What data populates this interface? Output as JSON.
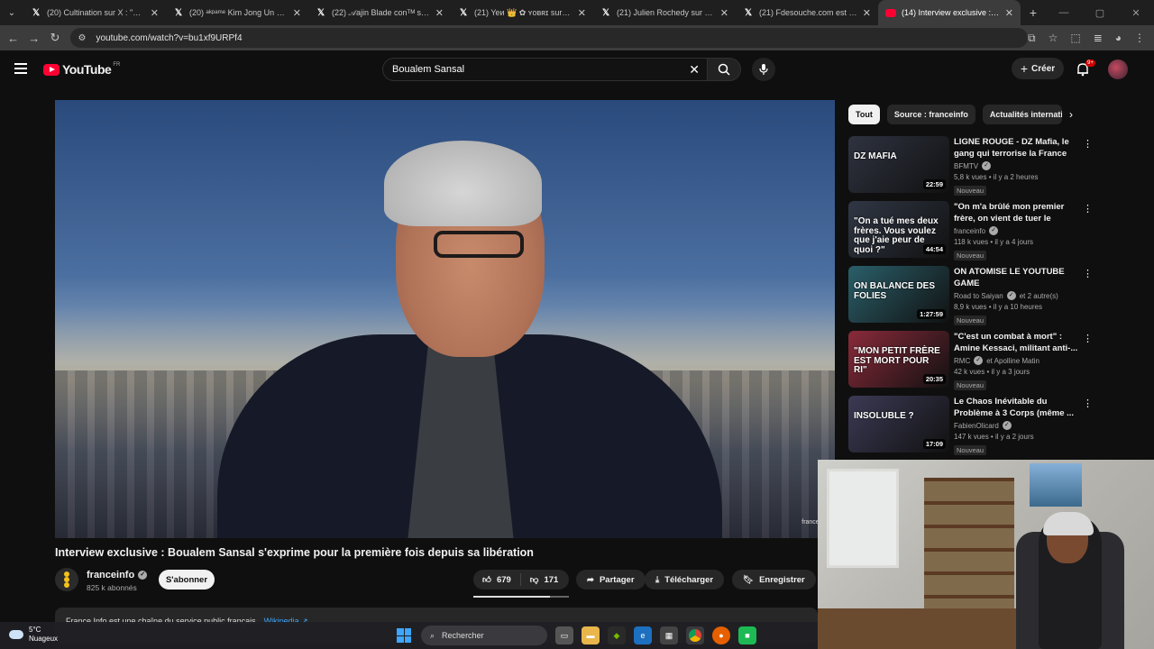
{
  "browser": {
    "tabs": [
      {
        "title": "(20) Cultination sur X : \"« C'est l",
        "icon": "x-logo-icon",
        "active": false
      },
      {
        "title": "(20) ᵃᵏᵖᵃᵐᵉ Kim Jong Un sur X : \"l",
        "icon": "x-logo-icon",
        "active": false
      },
      {
        "title": "(22) 𝒜ajin Blade conᵀᴹ sur X : \"",
        "icon": "x-logo-icon",
        "active": false
      },
      {
        "title": "(21) Yeи 👑 ✿ ʏᴏʙʀɪ sur X : \"V",
        "icon": "x-logo-icon",
        "active": false
      },
      {
        "title": "(21) Julien Rochedy sur X : \"Dis",
        "icon": "x-logo-icon",
        "active": false
      },
      {
        "title": "(21) Fdesouche.com est une re",
        "icon": "x-logo-icon",
        "active": false
      },
      {
        "title": "(14) Interview exclusive : Bo",
        "icon": "youtube-icon",
        "active": true
      }
    ],
    "url": "youtube.com/watch?v=bu1xf9URPf4"
  },
  "header": {
    "logo": "YouTube",
    "country": "FR",
    "search_value": "Boualem Sansal",
    "create_label": "Créer",
    "notif_count": "9+"
  },
  "video": {
    "title": "Interview exclusive : Boualem Sansal s'exprime pour la première fois depuis sa libération",
    "watermark": "franceinfo",
    "channel": "franceinfo",
    "subscribers": "825 k abonnés",
    "subscribe_label": "S'abonner",
    "likes": "679",
    "dislikes": "171",
    "like_ratio": 0.8,
    "share_label": "Partager",
    "download_label": "Télécharger",
    "save_label": "Enregistrer",
    "description": "France Info est une chaîne du service public français.",
    "wiki_link": "Wikipedia ↗"
  },
  "chips": [
    "Tout",
    "Source : franceinfo",
    "Actualités internationales"
  ],
  "recommendations": [
    {
      "title": "LIGNE ROUGE - DZ Mafia, le gang qui terrorise la France",
      "channel": "BFMTV",
      "verified": true,
      "channel_extra": "",
      "stats": "5,8 k vues • il y a 2 heures",
      "badge": "Nouveau",
      "duration": "22:59",
      "thumb_text": "DZ MAFIA",
      "thumb_color": "#2e3340"
    },
    {
      "title": "\"On m'a brûlé mon premier frère, on vient de tuer le deuxième. ...",
      "channel": "franceinfo",
      "verified": true,
      "channel_extra": "",
      "stats": "118 k vues • il y a 4 jours",
      "badge": "Nouveau",
      "duration": "44:54",
      "thumb_text": "\"On a tué mes deux frères. Vous voulez que j'aie peur de quoi ?\"",
      "thumb_color": "#303745"
    },
    {
      "title": "ON ATOMISE LE YOUTUBE GAME @JeanOncheLeMusclay",
      "channel": "Road to Saiyan",
      "verified": true,
      "channel_extra": "et 2 autre(s)",
      "stats": "8,9 k vues • il y a 10 heures",
      "badge": "Nouveau",
      "duration": "1:27:59",
      "thumb_text": "ON BALANCE DES FOLIES",
      "thumb_color": "#2a5f6a"
    },
    {
      "title": "\"C'est un combat à mort\" : Amine Kessaci, militant anti-...",
      "channel": "RMC",
      "verified": true,
      "channel_extra": "et Apolline Matin",
      "stats": "42 k vues • il y a 3 jours",
      "badge": "Nouveau",
      "duration": "20:35",
      "thumb_text": "\"MON PETIT FRÈRE EST MORT POUR RI\"",
      "thumb_color": "#8a2a3a"
    },
    {
      "title": "Le Chaos Inévitable du Problème à 3 Corps (même ...",
      "channel": "FabienOlicard",
      "verified": true,
      "channel_extra": "",
      "stats": "147 k vues • il y a 2 jours",
      "badge": "Nouveau",
      "duration": "17:09",
      "thumb_text": "INSOLUBLE ?",
      "thumb_color": "#3c3a55"
    }
  ],
  "taskbar": {
    "temperature": "5°C",
    "weather": "Nuageux",
    "search_placeholder": "Rechercher"
  }
}
